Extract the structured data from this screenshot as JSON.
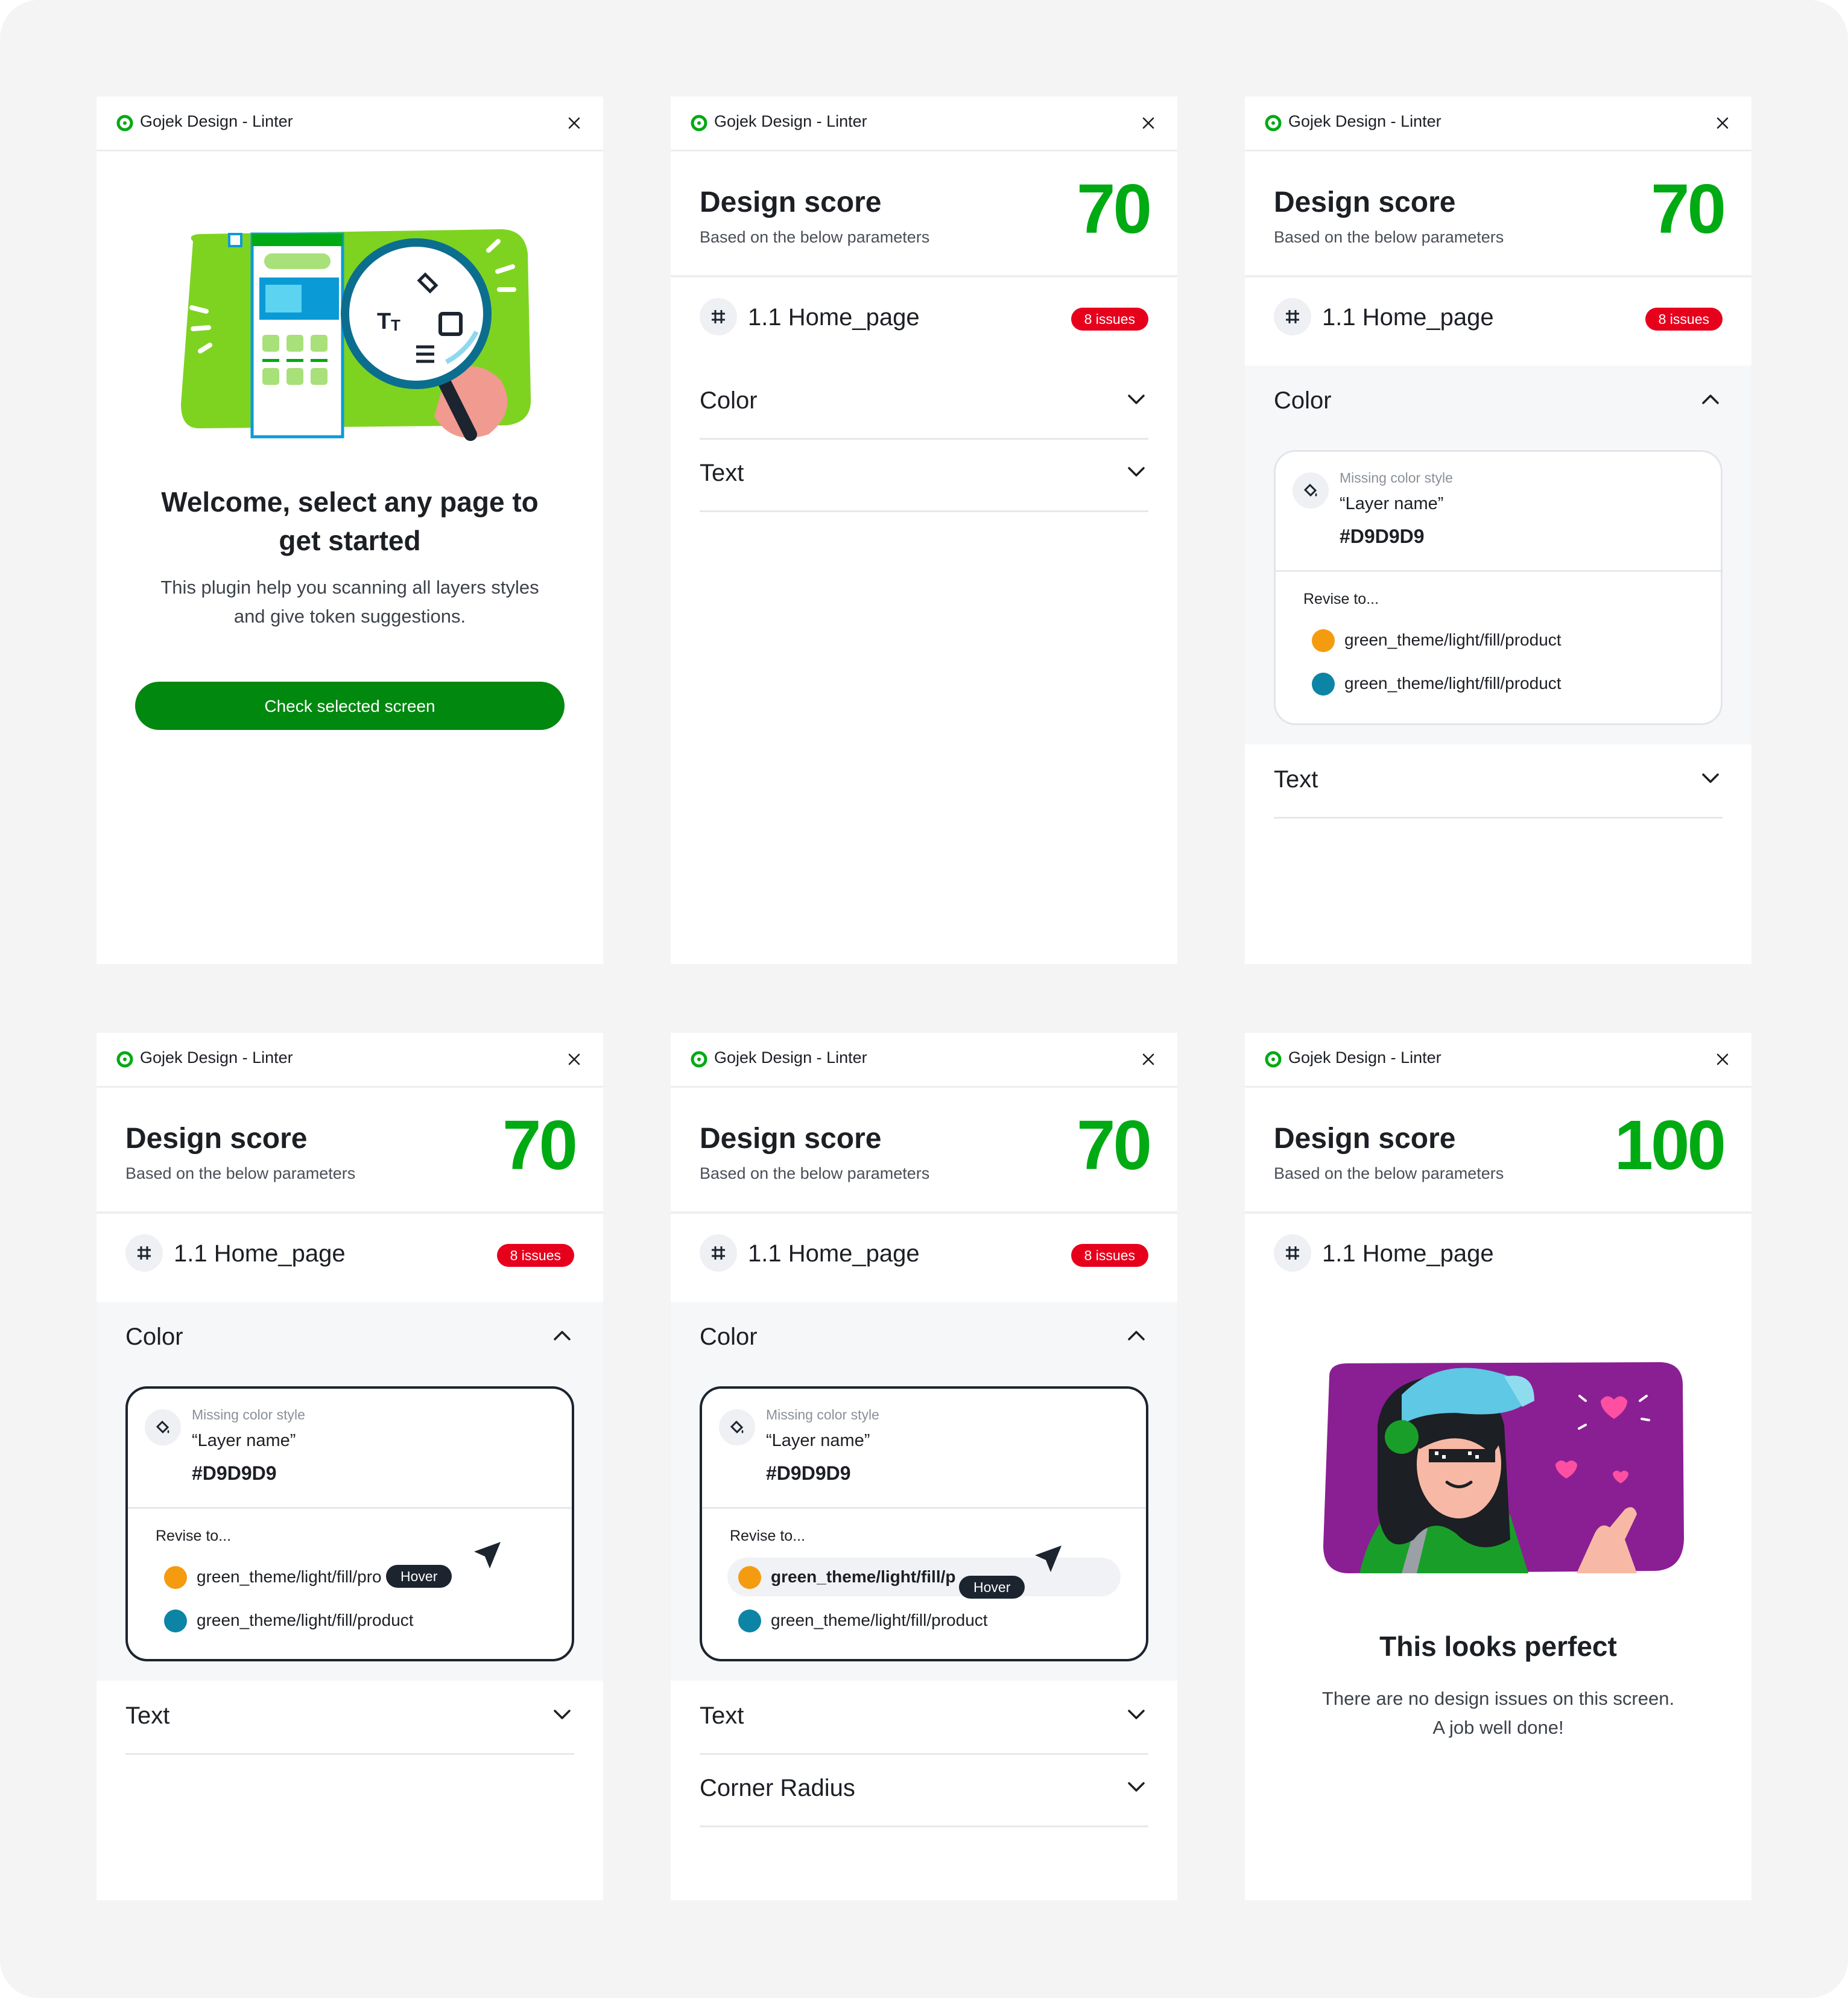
{
  "app": {
    "title": "Gojek Design - Linter",
    "brand_color": "#00AA13"
  },
  "welcome": {
    "title_line1": "Welcome, select any page to",
    "title_line2": "get started",
    "subtitle_line1": "This plugin help you scanning all layers styles",
    "subtitle_line2": "and give token suggestions.",
    "button_label": "Check selected screen"
  },
  "score": {
    "title": "Design score",
    "subtitle": "Based on the below parameters",
    "value": "70",
    "value_perfect": "100"
  },
  "page": {
    "name": "1.1 Home_page",
    "issues": "8 issues"
  },
  "sections": {
    "color": "Color",
    "text": "Text",
    "corner_radius": "Corner Radius"
  },
  "issue": {
    "caption": "Missing color style",
    "layer_name": "“Layer name”",
    "hex": "#D9D9D9",
    "revise_label": "Revise to...",
    "tokens": [
      {
        "label": "green_theme/light/fill/product",
        "swatch": "#F59B0F"
      },
      {
        "label": "green_theme/light/fill/product",
        "swatch": "#0C84A6"
      }
    ],
    "truncated_label": "green_theme/light/fill/pro",
    "truncated_label_hl": "green_theme/light/fill/p",
    "hover": "Hover"
  },
  "success": {
    "title": "This looks perfect",
    "subtitle_line1": "There are no design issues on this screen.",
    "subtitle_line2": "A job well done!"
  }
}
